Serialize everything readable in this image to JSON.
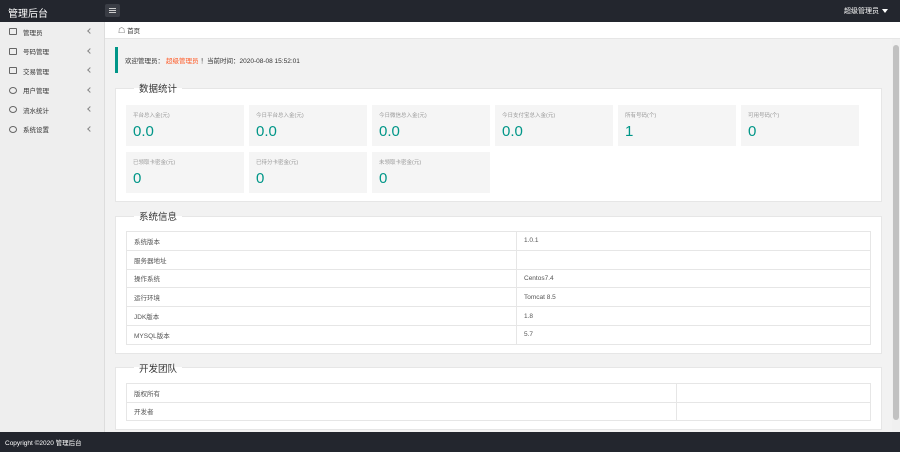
{
  "header": {
    "title": "管理后台",
    "user": "超级管理员"
  },
  "sidebar": {
    "items": [
      {
        "label": "管理员"
      },
      {
        "label": "号码管理"
      },
      {
        "label": "交易管理"
      },
      {
        "label": "用户管理"
      },
      {
        "label": "流水统计"
      },
      {
        "label": "系统设置"
      }
    ]
  },
  "breadcrumb": {
    "home": "首页"
  },
  "welcome": {
    "prefix": "欢迎管理员：",
    "role": "超级管理员",
    "suffix": "！当前时间：2020-08-08 15:52:01"
  },
  "stats": {
    "title": "数据统计",
    "items": [
      {
        "label": "平台总入金(元)",
        "value": "0.0"
      },
      {
        "label": "今日平台总入金(元)",
        "value": "0.0"
      },
      {
        "label": "今日微信总入金(元)",
        "value": "0.0"
      },
      {
        "label": "今日支付宝总入金(元)",
        "value": "0.0"
      },
      {
        "label": "所有号码(个)",
        "value": "1"
      },
      {
        "label": "可用号码(个)",
        "value": "0"
      },
      {
        "label": "已领取卡密金(元)",
        "value": "0"
      },
      {
        "label": "已待分卡密金(元)",
        "value": "0"
      },
      {
        "label": "未领取卡密金(元)",
        "value": "0"
      }
    ]
  },
  "sysinfo": {
    "title": "系统信息",
    "rows": [
      {
        "key": "系统版本",
        "value": "1.0.1"
      },
      {
        "key": "服务器地址",
        "value": ""
      },
      {
        "key": "操作系统",
        "value": "Centos7.4"
      },
      {
        "key": "运行环境",
        "value": "Tomcat 8.5"
      },
      {
        "key": "JDK版本",
        "value": "1.8"
      },
      {
        "key": "MYSQL版本",
        "value": "5.7"
      }
    ]
  },
  "team": {
    "title": "开发团队",
    "rows": [
      {
        "key": "版权所有",
        "value": ""
      },
      {
        "key": "开发者",
        "value": ""
      }
    ]
  },
  "footer": {
    "copyright": "Copyright ©2020 管理后台"
  }
}
